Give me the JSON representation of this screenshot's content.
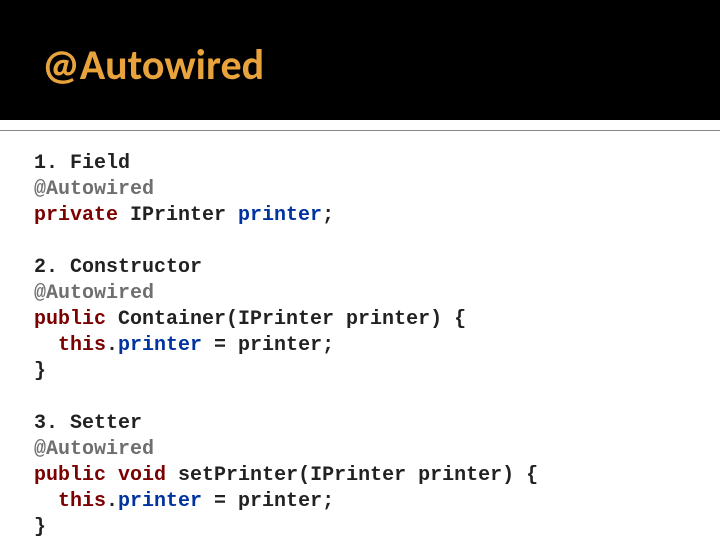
{
  "header": {
    "title": "@Autowired"
  },
  "code": {
    "s1_label": "1. Field",
    "anno": "@Autowired",
    "s1_mod": "private",
    "s1_type": " IPrinter ",
    "s1_name": "printer",
    "semi": ";",
    "s2_label": "2. Constructor",
    "s2_mod": "public",
    "s2_sig": " Container(IPrinter printer) {",
    "indent_this": "  this",
    "dot": ".",
    "assign_name": "printer",
    "assign_rest": " = printer;",
    "close": "}",
    "s3_label": "3. Setter",
    "s3_mod1": "public",
    "space": " ",
    "s3_mod2": "void",
    "s3_sig": " setPrinter(IPrinter printer) {"
  }
}
